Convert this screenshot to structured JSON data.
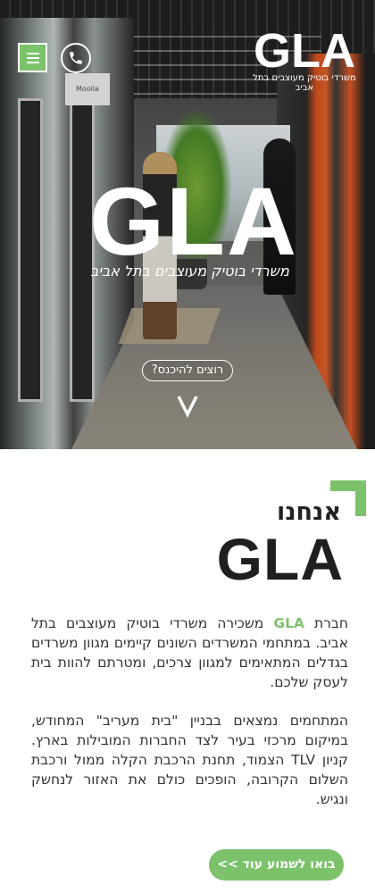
{
  "header": {
    "logo_text": "GLA",
    "tagline": "משרדי בוטיק מעוצבים בתל אביב",
    "menu_icon": "hamburger-menu-icon",
    "phone_icon": "phone-icon"
  },
  "hero": {
    "sign_text": "Moolla",
    "logo_text": "GLA",
    "tagline": "משרדי בוטיק מעוצבים בתל אביב",
    "enter_button": "רוצים להיכנס?",
    "scroll_icon": "chevron-down-icon"
  },
  "about": {
    "title": "אנחנו",
    "logo_text": "GLA",
    "para1_before": "חברת ",
    "para1_brand": "GLA",
    "para1_after": " משכירה משרדי בוטיק מעוצבים בתל אביב. במתחמי המשרדים השונים קיימים מגוון משרדים בגדלים המתאימים למגוון צרכים, ומטרתם להוות בית לעסק שלכם.",
    "para2": "המתחמים נמצאים בבניין \"בית מעריב\" המחודש, במיקום מרכזי בעיר לצד החברות המובילות בארץ. קניון TLV הצמוד, תחנת הרכבת הקלה ממול ורכבת השלום הקרובה, הופכים כולם את האזור לנחשק ונגיש.",
    "more_button": "בואו לשמוע עוד >>"
  },
  "colors": {
    "accent": "#7bc26a",
    "text": "#333333"
  }
}
